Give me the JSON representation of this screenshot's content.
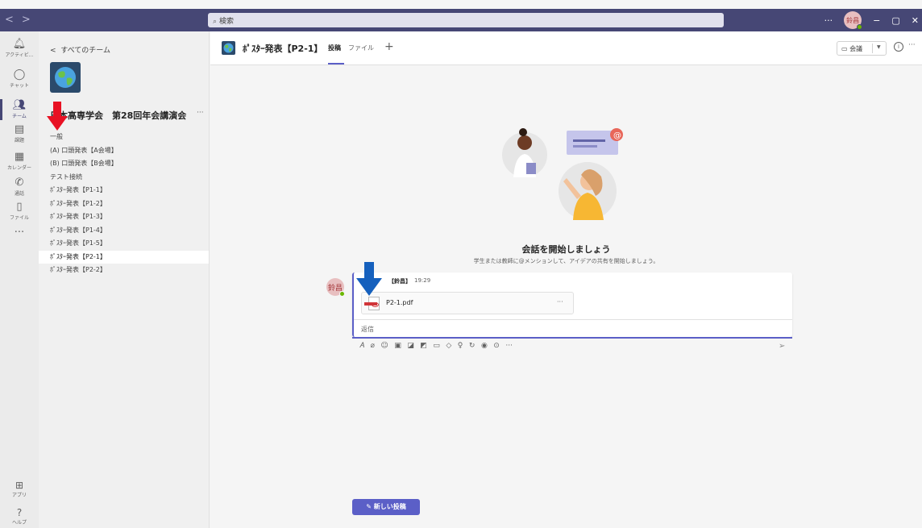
{
  "window": {
    "search_placeholder": "検索",
    "more": "···",
    "user_initials": "鈴昌",
    "minimize": "−",
    "maximize": "▢",
    "close": "✕"
  },
  "rail": {
    "items": [
      {
        "label": "アクティビ...",
        "icon": "bell-icon"
      },
      {
        "label": "チャット",
        "icon": "chat-icon"
      },
      {
        "label": "チーム",
        "icon": "teams-icon"
      },
      {
        "label": "課題",
        "icon": "assignments-icon"
      },
      {
        "label": "カレンダー",
        "icon": "calendar-icon"
      },
      {
        "label": "通話",
        "icon": "phone-icon"
      },
      {
        "label": "ファイル",
        "icon": "file-icon"
      }
    ],
    "more": "···",
    "apps_label": "アプリ",
    "help_label": "ヘルプ"
  },
  "team_panel": {
    "back_label": "すべてのチーム",
    "team_name": "日本高専学会　第28回年会講演会",
    "more": "···",
    "channels": [
      "一般",
      "(A) 口頭発表【A会場】",
      "(B) 口頭発表【B会場】",
      "テスト接続",
      "ﾎﾟｽﾀｰ発表【P1-1】",
      "ﾎﾟｽﾀｰ発表【P1-2】",
      "ﾎﾟｽﾀｰ発表【P1-3】",
      "ﾎﾟｽﾀｰ発表【P1-4】",
      "ﾎﾟｽﾀｰ発表【P1-5】",
      "ﾎﾟｽﾀｰ発表【P2-1】",
      "ﾎﾟｽﾀｰ発表【P2-2】"
    ],
    "active_channel_index": 9
  },
  "header": {
    "channel_title": "ﾎﾟｽﾀｰ発表【P2-1】",
    "tabs": [
      "投稿",
      "ファイル"
    ],
    "add_tab": "+",
    "meet_label": "会議",
    "info": "i",
    "more": "···"
  },
  "welcome": {
    "title": "会話を開始しましょう",
    "subtitle": "学生または教師に@メンションして、アイデアの共有を開始しましょう。"
  },
  "post": {
    "avatar_initials": "鈴昌",
    "author": "【鈴昌】",
    "time": "19:29",
    "file_name": "P2-1.pdf",
    "file_more": "···",
    "reply_label": "返信"
  },
  "compose_toolbar": [
    "format-icon",
    "attach-icon",
    "emoji-icon",
    "gif-icon",
    "sticker-icon",
    "meet-now-icon",
    "video-icon",
    "send-praise-icon",
    "idea-icon",
    "loop-icon",
    "approvals-icon",
    "stream-icon",
    "more-icon"
  ],
  "new_post_label": "新しい投稿",
  "accent_color": "#5b5fc7",
  "titlebar_color": "#464775"
}
